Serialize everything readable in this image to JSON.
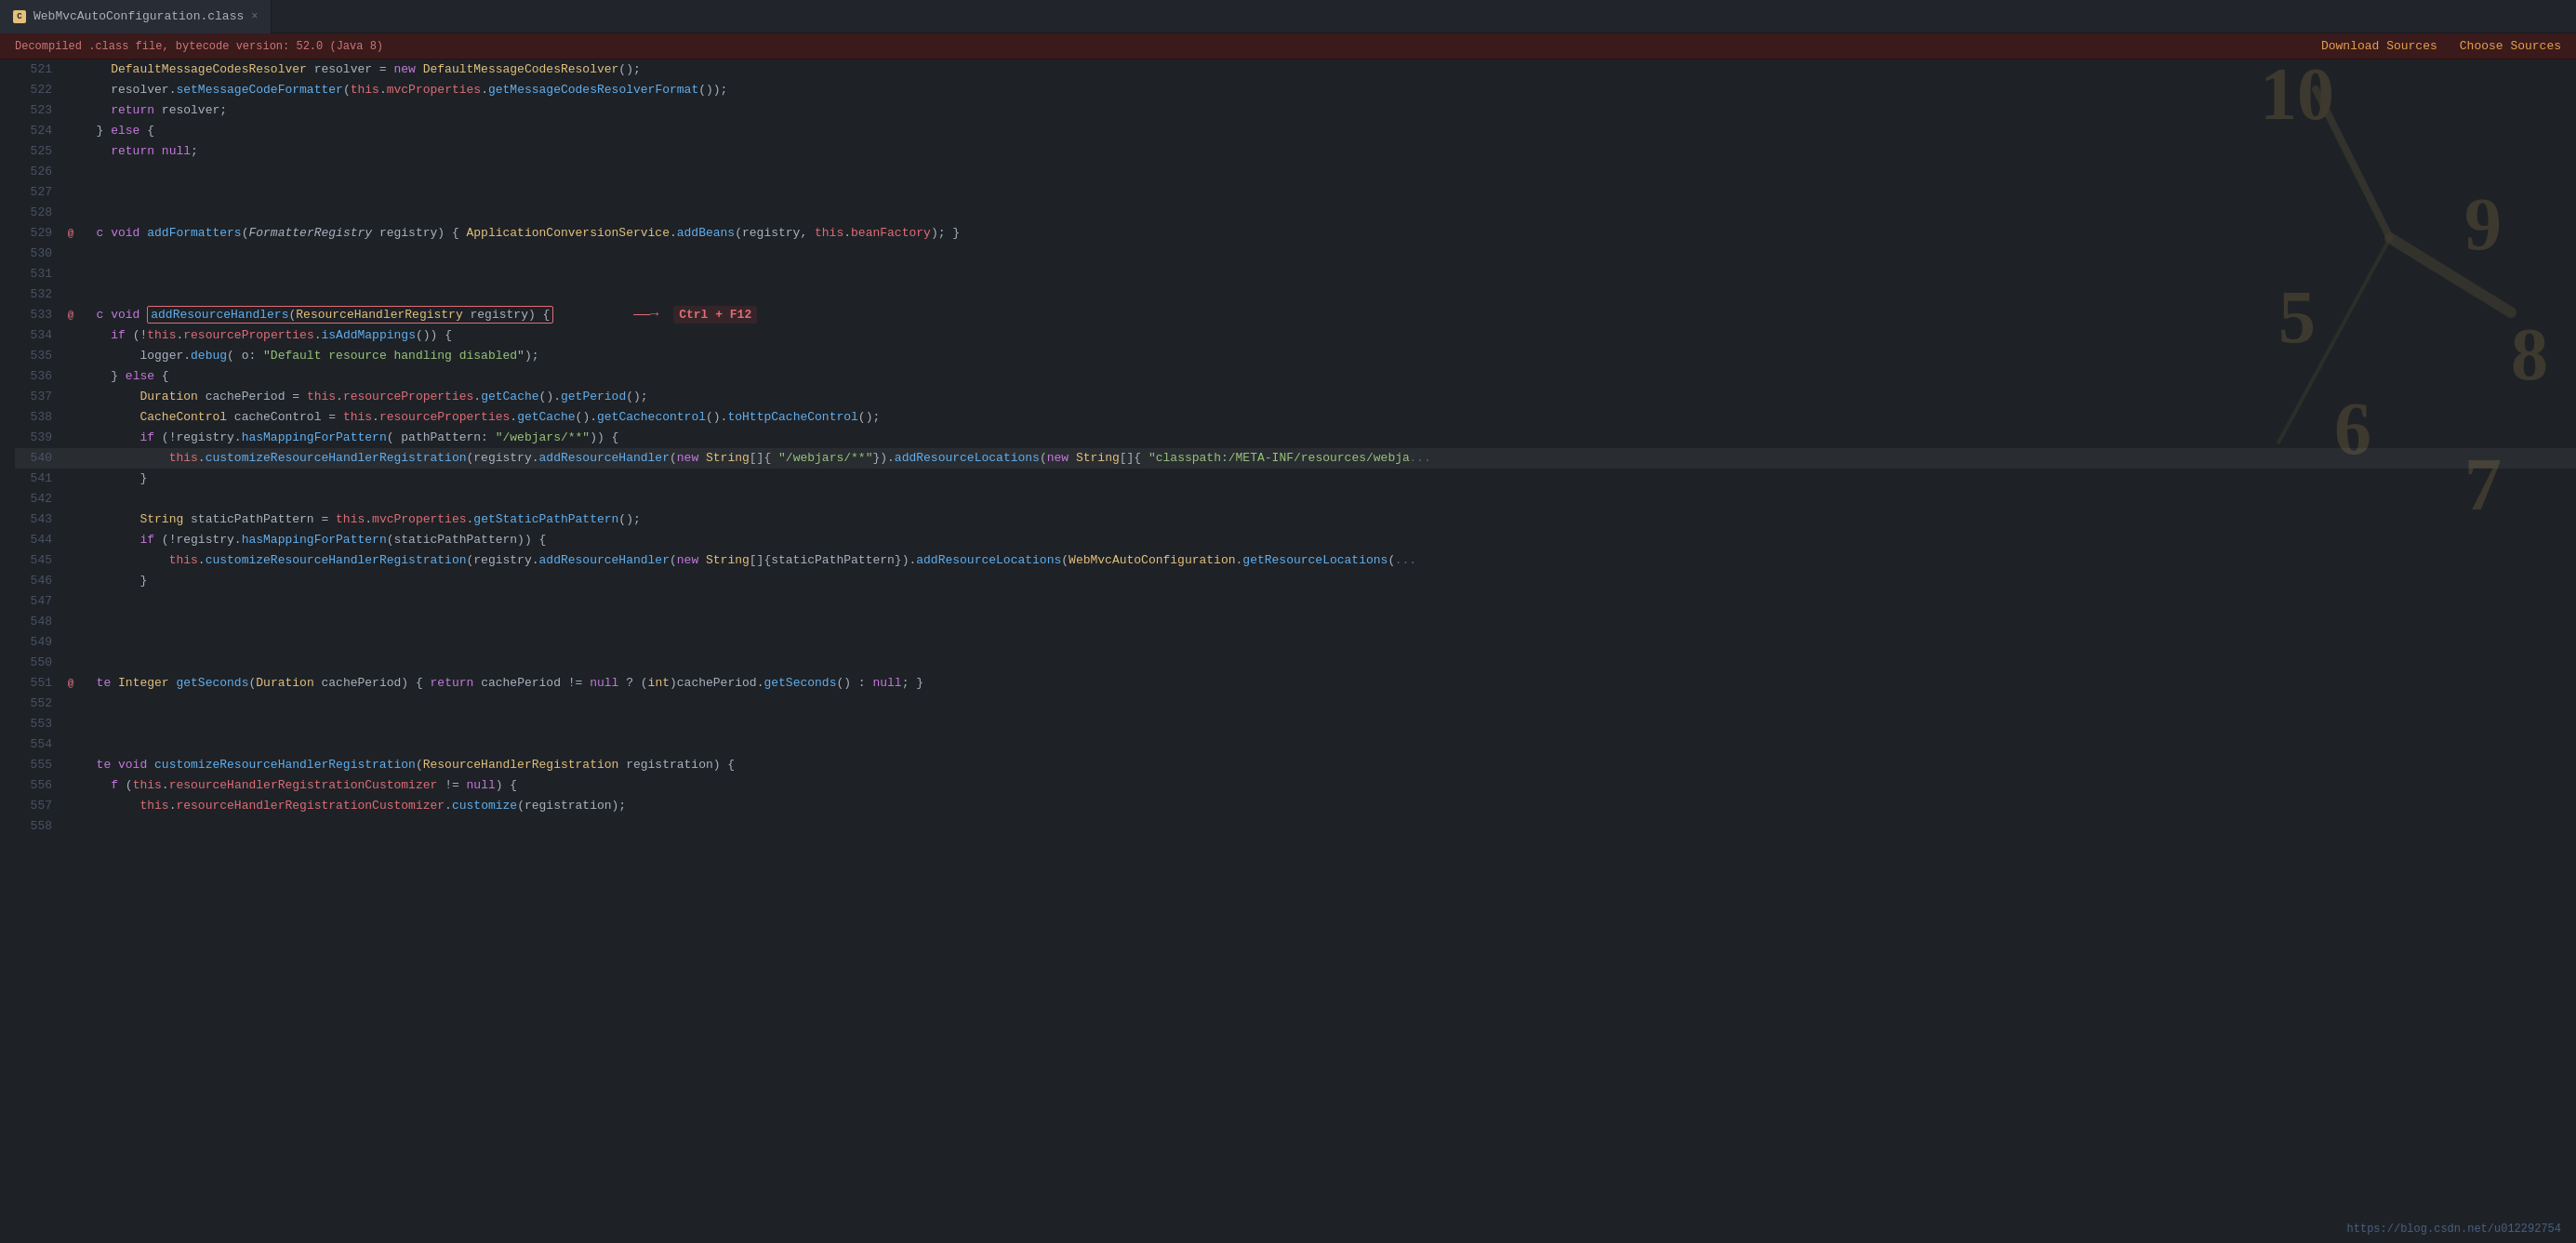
{
  "tab": {
    "icon_char": "C",
    "label": "WebMvcAutoConfiguration.class",
    "close": "×"
  },
  "info_bar": {
    "text": "Decompiled .class file, bytecode version: 52.0 (Java 8)",
    "download_sources": "Download Sources",
    "choose_sources": "Choose Sources"
  },
  "annotation": {
    "arrow": "→",
    "shortcut": "Ctrl + F12"
  },
  "url": "https://blog.csdn.net/u012292754",
  "lines": [
    {
      "num": "521",
      "gutter": "",
      "code": "default_message_codes"
    },
    {
      "num": "522",
      "gutter": "",
      "code": "resolver_set"
    },
    {
      "num": "523",
      "gutter": "",
      "code": "return_resolver"
    },
    {
      "num": "524",
      "gutter": "",
      "code": "else_open"
    },
    {
      "num": "525",
      "gutter": "",
      "code": "return_null"
    },
    {
      "num": "526",
      "gutter": "",
      "code": "blank"
    },
    {
      "num": "527",
      "gutter": "",
      "code": "blank"
    },
    {
      "num": "528",
      "gutter": "",
      "code": "blank"
    },
    {
      "num": "529",
      "gutter": "@",
      "code": "add_formatters"
    },
    {
      "num": "530",
      "gutter": "",
      "code": "blank"
    },
    {
      "num": "531",
      "gutter": "",
      "code": "blank"
    },
    {
      "num": "532",
      "gutter": "",
      "code": "blank"
    },
    {
      "num": "533",
      "gutter": "@",
      "code": "add_resource_handlers"
    },
    {
      "num": "534",
      "gutter": "",
      "code": "if_not_add"
    },
    {
      "num": "535",
      "gutter": "",
      "code": "logger_debug"
    },
    {
      "num": "536",
      "gutter": "",
      "code": "else_open2"
    },
    {
      "num": "537",
      "gutter": "",
      "code": "duration_cache"
    },
    {
      "num": "538",
      "gutter": "",
      "code": "cache_control"
    },
    {
      "num": "539",
      "gutter": "",
      "code": "if_webjars"
    },
    {
      "num": "540",
      "gutter": "",
      "code": "customize_webjars"
    },
    {
      "num": "541",
      "gutter": "",
      "code": "close_brace"
    },
    {
      "num": "542",
      "gutter": "",
      "code": "blank"
    },
    {
      "num": "543",
      "gutter": "",
      "code": "string_static"
    },
    {
      "num": "544",
      "gutter": "",
      "code": "if_static"
    },
    {
      "num": "545",
      "gutter": "",
      "code": "customize_static"
    },
    {
      "num": "546",
      "gutter": "",
      "code": "close_brace2"
    },
    {
      "num": "547",
      "gutter": "",
      "code": "blank"
    },
    {
      "num": "548",
      "gutter": "",
      "code": "blank"
    },
    {
      "num": "549",
      "gutter": "",
      "code": "blank"
    },
    {
      "num": "550",
      "gutter": "",
      "code": "blank"
    },
    {
      "num": "551",
      "gutter": "@",
      "code": "get_seconds"
    },
    {
      "num": "552",
      "gutter": "",
      "code": "blank"
    },
    {
      "num": "553",
      "gutter": "",
      "code": "blank"
    },
    {
      "num": "554",
      "gutter": "",
      "code": "blank"
    },
    {
      "num": "555",
      "gutter": "",
      "code": "customize_registration"
    },
    {
      "num": "556",
      "gutter": "",
      "code": "if_customizer"
    },
    {
      "num": "557",
      "gutter": "",
      "code": "customizer_customize"
    },
    {
      "num": "558",
      "gutter": "",
      "code": "blank"
    }
  ]
}
